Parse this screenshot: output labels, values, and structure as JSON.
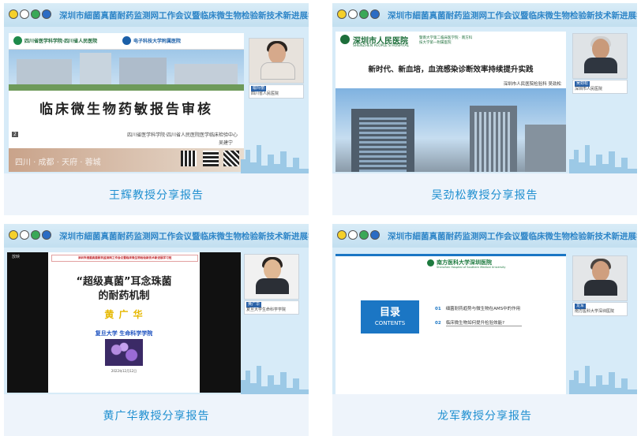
{
  "banner_title": "深圳市細菌真菌耐药监测网工作会议暨临床微生物检验新技术新进展学习班",
  "cards": [
    {
      "caption": "王辉教授分享报告",
      "slide": {
        "header_left": "四川省医学科学院·四川省人民医院",
        "header_right": "电子科技大学附属医院",
        "title": "临床微生物药敏报告审核",
        "affiliation": "四川省医学科学院·四川省人民医院医学临床检验中心",
        "presenter": "吴建宁",
        "page_num": "2",
        "watermark": "四川 · 成都 · 天府 · 蓉城"
      },
      "speaker": {
        "name": "喻玲丽",
        "org": "四川省人民医院"
      }
    },
    {
      "caption": "吴劲松教授分享报告",
      "slide": {
        "hospital_cn": "深圳市人民医院",
        "hospital_en": "SHENZHEN PEOPLE'S HOSPITAL",
        "hospital_note": "暨南大学第二临床医学院 · 南方科技大学第一附属医院",
        "title": "新时代、新血培，血流感染诊断效率持续提升实践",
        "affiliation": "深圳市人民医院检验科 吴劲松"
      },
      "speaker": {
        "name": "吴劲松",
        "org": "深圳市人民医院"
      }
    },
    {
      "caption": "黄广华教授分享报告",
      "slide": {
        "header": "深圳市细菌真菌耐药监测网工作会议暨临床微生物检验新技术新进展学习班",
        "title_line1": "“超级真菌”耳念珠菌",
        "title_line2": "的耐药机制",
        "presenter": "黄 广 华",
        "affiliation": "复旦大学 生命科学学院",
        "date": "2022年12月12日",
        "toolbar_label": "放映"
      },
      "speaker": {
        "name": "黄广华",
        "org": "复旦大学生命科学学院"
      }
    },
    {
      "caption": "龙军教授分享报告",
      "slide": {
        "logo_cn": "南方医科大学深圳医院",
        "logo_en": "Shenzhen Hospital of Southern Medical University",
        "toc_cn": "目录",
        "toc_en": "CONTENTS",
        "items": [
          {
            "num": "01",
            "text": "细菌耐药趋势与微生物在AMS中的作用"
          },
          {
            "num": "02",
            "text": "临床微生物如何提升检验效能?"
          }
        ]
      },
      "speaker": {
        "name": "龙军",
        "org": "南方医科大学深圳医院"
      }
    }
  ],
  "colors": {
    "caption": "#1f8fd0",
    "banner_text": "#2f86c8",
    "card_bg": "#eef4fb",
    "toc_blue": "#1b76c4",
    "presenter_yellow": "#e6b800",
    "affil_blue": "#1a4fbf",
    "slide_title_red": "#c0282d"
  }
}
